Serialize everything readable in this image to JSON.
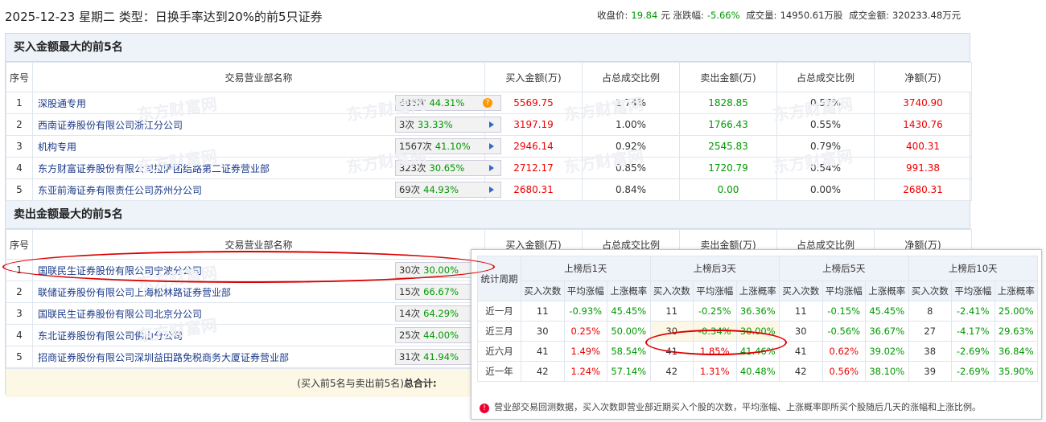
{
  "header": {
    "title": "2025-12-23 星期二 类型：日换手率达到20%的前5只证券"
  },
  "stats": {
    "close_label": "收盘价:",
    "close": "19.84",
    "close_unit": "元",
    "change_label": "涨跌幅:",
    "change": "-5.66%",
    "volume_label": "成交量:",
    "volume": "14950.61万股",
    "amount_label": "成交金额:",
    "amount": "320233.48万元"
  },
  "buy": {
    "title": "买入金额最大的前5名",
    "cols": [
      "序号",
      "交易营业部名称",
      "买入金额(万)",
      "占总成交比例",
      "卖出金额(万)",
      "占总成交比例",
      "净额(万)"
    ],
    "rows": [
      {
        "no": "1",
        "name": "深股通专用",
        "cnt": "686次",
        "pct": "44.31%",
        "buy": "5569.75",
        "buy_ratio": "1.74%",
        "sell": "1828.85",
        "sell_ratio": "0.57%",
        "net": "3740.90"
      },
      {
        "no": "2",
        "name": "西南证券股份有限公司浙江分公司",
        "cnt": "3次",
        "pct": "33.33%",
        "buy": "3197.19",
        "buy_ratio": "1.00%",
        "sell": "1766.43",
        "sell_ratio": "0.55%",
        "net": "1430.76"
      },
      {
        "no": "3",
        "name": "机构专用",
        "cnt": "1567次",
        "pct": "41.10%",
        "buy": "2946.14",
        "buy_ratio": "0.92%",
        "sell": "2545.83",
        "sell_ratio": "0.79%",
        "net": "400.31"
      },
      {
        "no": "4",
        "name": "东方财富证券股份有限公司拉萨团结路第二证券营业部",
        "cnt": "323次",
        "pct": "30.65%",
        "buy": "2712.17",
        "buy_ratio": "0.85%",
        "sell": "1720.79",
        "sell_ratio": "0.54%",
        "net": "991.38"
      },
      {
        "no": "5",
        "name": "东亚前海证券有限责任公司苏州分公司",
        "cnt": "69次",
        "pct": "44.93%",
        "buy": "2680.31",
        "buy_ratio": "0.84%",
        "sell": "0.00",
        "sell_ratio": "0.00%",
        "net": "2680.31"
      }
    ]
  },
  "sell": {
    "title": "卖出金额最大的前5名",
    "cols": [
      "序号",
      "交易营业部名称",
      "买入金额(万)",
      "占总成交比例",
      "卖出金额(万)",
      "占总成交比例",
      "净额(万)"
    ],
    "rows": [
      {
        "no": "1",
        "name": "国联民生证券股份有限公司宁波分公司",
        "cnt": "30次",
        "pct": "30.00%"
      },
      {
        "no": "2",
        "name": "联储证券股份有限公司上海松林路证券营业部",
        "cnt": "15次",
        "pct": "66.67%"
      },
      {
        "no": "3",
        "name": "国联民生证券股份有限公司北京分公司",
        "cnt": "14次",
        "pct": "64.29%"
      },
      {
        "no": "4",
        "name": "东北证券股份有限公司佛山分公司",
        "cnt": "25次",
        "pct": "44.00%"
      },
      {
        "no": "5",
        "name": "招商证券股份有限公司深圳益田路免税商务大厦证券营业部",
        "cnt": "31次",
        "pct": "41.94%"
      }
    ],
    "total_prefix": "(买入前5名与卖出前5名)",
    "total_label": "总合计:"
  },
  "popup": {
    "period_label": "统计周期",
    "groups": [
      "上榜后1天",
      "上榜后3天",
      "上榜后5天",
      "上榜后10天"
    ],
    "subcols": [
      "买入次数",
      "平均涨幅",
      "上涨概率"
    ],
    "rows": [
      {
        "label": "近一月",
        "vals": [
          "11",
          "-0.93%",
          "45.45%",
          "11",
          "-0.25%",
          "36.36%",
          "11",
          "-0.15%",
          "45.45%",
          "8",
          "-2.41%",
          "25.00%"
        ]
      },
      {
        "label": "近三月",
        "vals": [
          "30",
          "0.25%",
          "50.00%",
          "30",
          "-0.34%",
          "30.00%",
          "30",
          "-0.56%",
          "36.67%",
          "27",
          "-4.17%",
          "29.63%"
        ]
      },
      {
        "label": "近六月",
        "vals": [
          "41",
          "1.49%",
          "58.54%",
          "41",
          "1.85%",
          "41.46%",
          "41",
          "0.62%",
          "39.02%",
          "38",
          "-2.69%",
          "36.84%"
        ]
      },
      {
        "label": "近一年",
        "vals": [
          "42",
          "1.24%",
          "57.14%",
          "42",
          "1.31%",
          "40.48%",
          "42",
          "0.56%",
          "38.10%",
          "39",
          "-2.69%",
          "35.90%"
        ]
      }
    ],
    "note": "营业部交易回测数据，买入次数即营业部近期买入个股的次数，平均涨幅、上涨概率即所买个股随后几天的涨幅和上涨比例。"
  },
  "watermark": "东方财富网",
  "colors": {
    "up": "#e00",
    "down": "#090",
    "header_bg": "#eef3fa",
    "highlight": "#fdf8e6"
  }
}
